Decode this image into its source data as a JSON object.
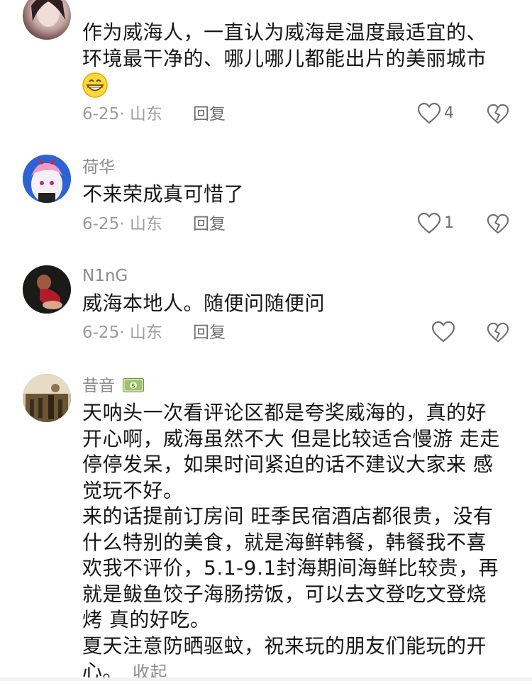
{
  "comments": [
    {
      "username": "",
      "lines": [
        "作为威海人，一直认为威海是温度最适宜的、",
        "环境最干净的、哪儿哪儿都能出片的美丽城市"
      ],
      "emoji": "grinning-face-emoji",
      "date_location": "6-25· 山东",
      "reply_label": "回复",
      "likes": "4"
    },
    {
      "username": "荷华",
      "lines": [
        "不来荣成真可惜了"
      ],
      "date_location": "6-25· 山东",
      "reply_label": "回复",
      "likes": "1"
    },
    {
      "username": "N1nG",
      "lines": [
        "威海本地人。随便问随便问"
      ],
      "date_location": "6-25· 山东",
      "reply_label": "回复",
      "likes": ""
    },
    {
      "username": "昔音",
      "badge": "money-badge-icon",
      "lines": [
        "天呐头一次看评论区都是夸奖威海的，真的好",
        "开心啊，威海虽然不大 但是比较适合慢游 走走",
        "停停发呆，如果时间紧迫的话不建议大家来 感",
        "觉玩不好。",
        "来的话提前订房间 旺季民宿酒店都很贵，没有",
        "什么特别的美食，就是海鲜韩餐，韩餐我不喜",
        "欢我不评价，5.1-9.1封海期间海鲜比较贵，再",
        "就是鲅鱼饺子海肠捞饭，可以去文登吃文登烧",
        "烤 真的好吃。",
        "夏天注意防晒驱蚊，祝来玩的朋友们能玩的开",
        "心。"
      ],
      "collapse_label": "收起"
    }
  ],
  "colors": {
    "text": "#161616",
    "muted": "#9c9c9c",
    "reply": "#6f6f6f"
  }
}
